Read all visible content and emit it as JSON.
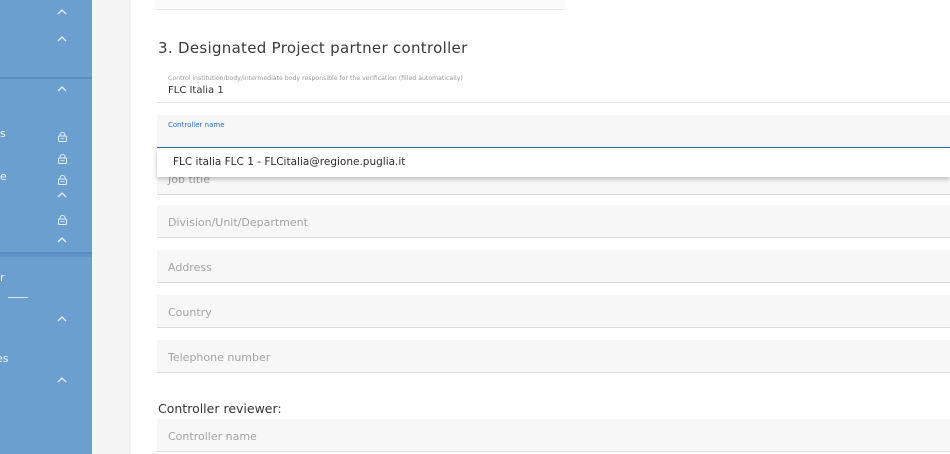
{
  "sidebar": {
    "fragments": [
      "s",
      "e",
      "r",
      "es"
    ],
    "icons": {
      "collapse": "chevron-up-icon",
      "lock": "lock-icon"
    }
  },
  "section": {
    "title": "3. Designated Project partner controller"
  },
  "control_institution": {
    "label": "Control institution/body/intermediate body responsible for the verification (filled automatically)",
    "value": "FLC Italia 1"
  },
  "controller_name": {
    "label": "Controller name"
  },
  "dropdown": {
    "option": "FLC italia FLC 1 - FLCitalia@regione.puglia.it"
  },
  "fields": {
    "job_title": "Job title",
    "division": "Division/Unit/Department",
    "address": "Address",
    "country": "Country",
    "telephone": "Telephone number"
  },
  "reviewer": {
    "heading": "Controller reviewer:",
    "name_placeholder": "Controller name"
  }
}
